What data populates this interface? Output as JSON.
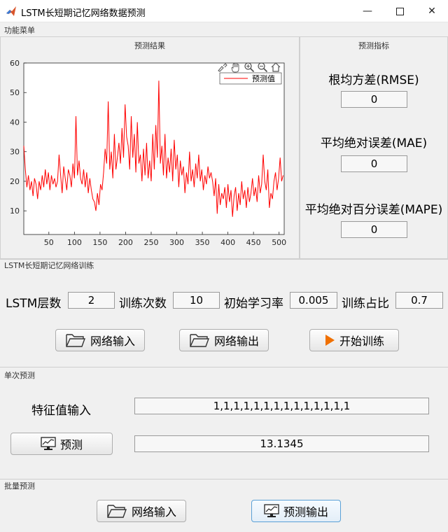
{
  "window": {
    "title": "LSTM长短期记忆网络数据预测"
  },
  "menu": {
    "label": "功能菜单"
  },
  "results_panel": {
    "title": "预测结果"
  },
  "metrics_panel": {
    "title": "预测指标",
    "rmse_label": "根均方差(RMSE)",
    "rmse_value": "0",
    "mae_label": "平均绝对误差(MAE)",
    "mae_value": "0",
    "mape_label": "平均绝对百分误差(MAPE)",
    "mape_value": "0"
  },
  "training": {
    "section_label": "LSTM长短期记忆网络训练",
    "layers_label": "LSTM层数",
    "layers_value": "2",
    "epochs_label": "训练次数",
    "epochs_value": "10",
    "lr_label": "初始学习率",
    "lr_value": "0.005",
    "ratio_label": "训练占比",
    "ratio_value": "0.7",
    "input_button": "网络输入",
    "output_button": "网络输出",
    "start_button": "开始训练"
  },
  "single": {
    "section_label": "单次预测",
    "feature_label": "特征值输入",
    "feature_value": "1,1,1,1,1,1,1,1,1,1,1,1,1,1",
    "predict_button": "预测",
    "result_value": "13.1345"
  },
  "batch": {
    "section_label": "批量预测",
    "input_button": "网络输入",
    "output_button": "预测输出"
  },
  "colors": {
    "series": "#ff0000",
    "accent_play": "#f07000"
  },
  "icons": [
    "matlab-icon",
    "minimize-icon",
    "maximize-icon",
    "close-icon",
    "folder-icon",
    "play-icon",
    "monitor-chart-icon",
    "pan-icon",
    "zoom-in-icon",
    "zoom-out-icon",
    "home-icon",
    "brush-icon"
  ],
  "chart_data": {
    "type": "line",
    "x_ticks": [
      50,
      100,
      150,
      200,
      250,
      300,
      350,
      400,
      450,
      500
    ],
    "y_ticks": [
      10,
      20,
      30,
      40,
      50,
      60
    ],
    "xlim": [
      1,
      510
    ],
    "ylim": [
      2,
      60
    ],
    "legend": "预测值",
    "legend_position": "top-right",
    "series": [
      {
        "name": "预测值",
        "color": "#ff0000",
        "points": [
          [
            1,
            32
          ],
          [
            4,
            24
          ],
          [
            7,
            18
          ],
          [
            10,
            22
          ],
          [
            13,
            17
          ],
          [
            16,
            20
          ],
          [
            19,
            15
          ],
          [
            22,
            21
          ],
          [
            25,
            19
          ],
          [
            28,
            14
          ],
          [
            31,
            20
          ],
          [
            34,
            17
          ],
          [
            37,
            22
          ],
          [
            40,
            18
          ],
          [
            43,
            24
          ],
          [
            46,
            19
          ],
          [
            49,
            23
          ],
          [
            52,
            17
          ],
          [
            55,
            22
          ],
          [
            58,
            19
          ],
          [
            61,
            21
          ],
          [
            64,
            18
          ],
          [
            67,
            20
          ],
          [
            70,
            29
          ],
          [
            73,
            22
          ],
          [
            76,
            16
          ],
          [
            79,
            25
          ],
          [
            82,
            21
          ],
          [
            85,
            17
          ],
          [
            88,
            24
          ],
          [
            91,
            22
          ],
          [
            94,
            18
          ],
          [
            97,
            26
          ],
          [
            100,
            21
          ],
          [
            103,
            42
          ],
          [
            106,
            22
          ],
          [
            109,
            27
          ],
          [
            112,
            21
          ],
          [
            115,
            19
          ],
          [
            118,
            24
          ],
          [
            121,
            18
          ],
          [
            124,
            23
          ],
          [
            127,
            16
          ],
          [
            130,
            21
          ],
          [
            133,
            17
          ],
          [
            136,
            14
          ],
          [
            139,
            13
          ],
          [
            142,
            10
          ],
          [
            145,
            16
          ],
          [
            148,
            12
          ],
          [
            151,
            19
          ],
          [
            154,
            17
          ],
          [
            157,
            23
          ],
          [
            160,
            31
          ],
          [
            163,
            26
          ],
          [
            166,
            47
          ],
          [
            169,
            24
          ],
          [
            172,
            30
          ],
          [
            175,
            21
          ],
          [
            178,
            36
          ],
          [
            181,
            24
          ],
          [
            184,
            28
          ],
          [
            187,
            33
          ],
          [
            190,
            26
          ],
          [
            193,
            38
          ],
          [
            196,
            28
          ],
          [
            199,
            46
          ],
          [
            202,
            35
          ],
          [
            205,
            32
          ],
          [
            208,
            24
          ],
          [
            211,
            42
          ],
          [
            214,
            28
          ],
          [
            217,
            36
          ],
          [
            220,
            23
          ],
          [
            223,
            40
          ],
          [
            226,
            26
          ],
          [
            229,
            29
          ],
          [
            232,
            20
          ],
          [
            235,
            31
          ],
          [
            238,
            22
          ],
          [
            241,
            33
          ],
          [
            244,
            21
          ],
          [
            247,
            27
          ],
          [
            250,
            20
          ],
          [
            253,
            36
          ],
          [
            256,
            24
          ],
          [
            259,
            39
          ],
          [
            262,
            28
          ],
          [
            265,
            54
          ],
          [
            268,
            26
          ],
          [
            271,
            32
          ],
          [
            274,
            22
          ],
          [
            277,
            36
          ],
          [
            280,
            21
          ],
          [
            283,
            28
          ],
          [
            286,
            23
          ],
          [
            289,
            31
          ],
          [
            292,
            20
          ],
          [
            295,
            34
          ],
          [
            298,
            24
          ],
          [
            301,
            29
          ],
          [
            304,
            18
          ],
          [
            307,
            27
          ],
          [
            310,
            22
          ],
          [
            313,
            25
          ],
          [
            316,
            16
          ],
          [
            319,
            23
          ],
          [
            322,
            19
          ],
          [
            325,
            30
          ],
          [
            328,
            20
          ],
          [
            331,
            24
          ],
          [
            334,
            18
          ],
          [
            337,
            26
          ],
          [
            340,
            21
          ],
          [
            343,
            29
          ],
          [
            346,
            20
          ],
          [
            349,
            24
          ],
          [
            352,
            17
          ],
          [
            355,
            22
          ],
          [
            358,
            19
          ],
          [
            361,
            25
          ],
          [
            364,
            21
          ],
          [
            367,
            23
          ],
          [
            370,
            20
          ],
          [
            373,
            15
          ],
          [
            376,
            21
          ],
          [
            379,
            9
          ],
          [
            382,
            19
          ],
          [
            385,
            12
          ],
          [
            388,
            16
          ],
          [
            391,
            14
          ],
          [
            394,
            18
          ],
          [
            397,
            11
          ],
          [
            400,
            19
          ],
          [
            403,
            13
          ],
          [
            406,
            17
          ],
          [
            409,
            8
          ],
          [
            412,
            15
          ],
          [
            415,
            18
          ],
          [
            418,
            10
          ],
          [
            421,
            16
          ],
          [
            424,
            12
          ],
          [
            427,
            20
          ],
          [
            430,
            14
          ],
          [
            433,
            17
          ],
          [
            436,
            11
          ],
          [
            439,
            18
          ],
          [
            442,
            13
          ],
          [
            445,
            16
          ],
          [
            448,
            21
          ],
          [
            451,
            15
          ],
          [
            454,
            18
          ],
          [
            457,
            13
          ],
          [
            460,
            22
          ],
          [
            463,
            16
          ],
          [
            466,
            19
          ],
          [
            469,
            29
          ],
          [
            472,
            20
          ],
          [
            475,
            17
          ],
          [
            478,
            24
          ],
          [
            481,
            11
          ],
          [
            484,
            16
          ],
          [
            487,
            14
          ],
          [
            490,
            20
          ],
          [
            493,
            23
          ],
          [
            496,
            17
          ],
          [
            499,
            21
          ],
          [
            502,
            28
          ],
          [
            505,
            20
          ],
          [
            508,
            22
          ]
        ]
      }
    ]
  }
}
